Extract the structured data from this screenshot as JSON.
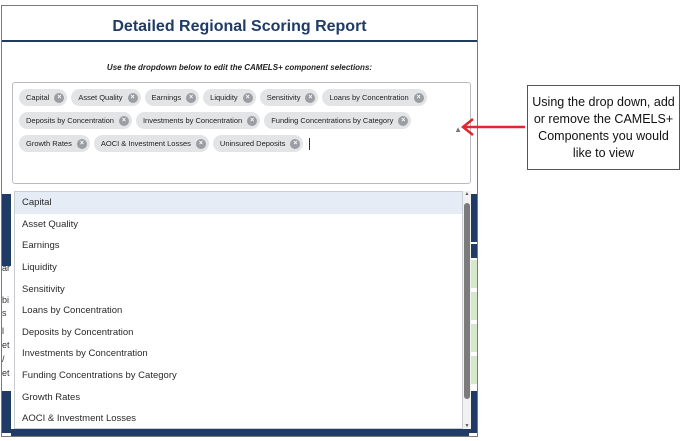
{
  "report": {
    "title": "Detailed Regional Scoring Report",
    "instructions": "Use the dropdown below to edit the CAMELS+ component selections:"
  },
  "selected_chips": [
    "Capital",
    "Asset Quality",
    "Earnings",
    "Liquidity",
    "Sensitivity",
    "Loans by Concentration",
    "Deposits by Concentration",
    "Investments by Concentration",
    "Funding Concentrations by Category",
    "Growth Rates",
    "AOCI & Investment Losses",
    "Uninsured Deposits"
  ],
  "dropdown_options": [
    "Capital",
    "Asset Quality",
    "Earnings",
    "Liquidity",
    "Sensitivity",
    "Loans by Concentration",
    "Deposits by Concentration",
    "Investments by Concentration",
    "Funding Concentrations by Category",
    "Growth Rates",
    "AOCI & Investment Losses"
  ],
  "dropdown_active_index": 0,
  "callout": {
    "text": "Using the drop down, add or remove the CAMELS+ Components you would like to view"
  },
  "colors": {
    "title": "#1f3b66",
    "arrow": "#e0282e",
    "chip_bg": "#e3e4e6",
    "menu_active": "#e6ecf5"
  },
  "icons": {
    "chip_remove": "close-circle-icon",
    "dropdown": "chevron-up-icon",
    "arrow": "left-arrow-icon"
  }
}
